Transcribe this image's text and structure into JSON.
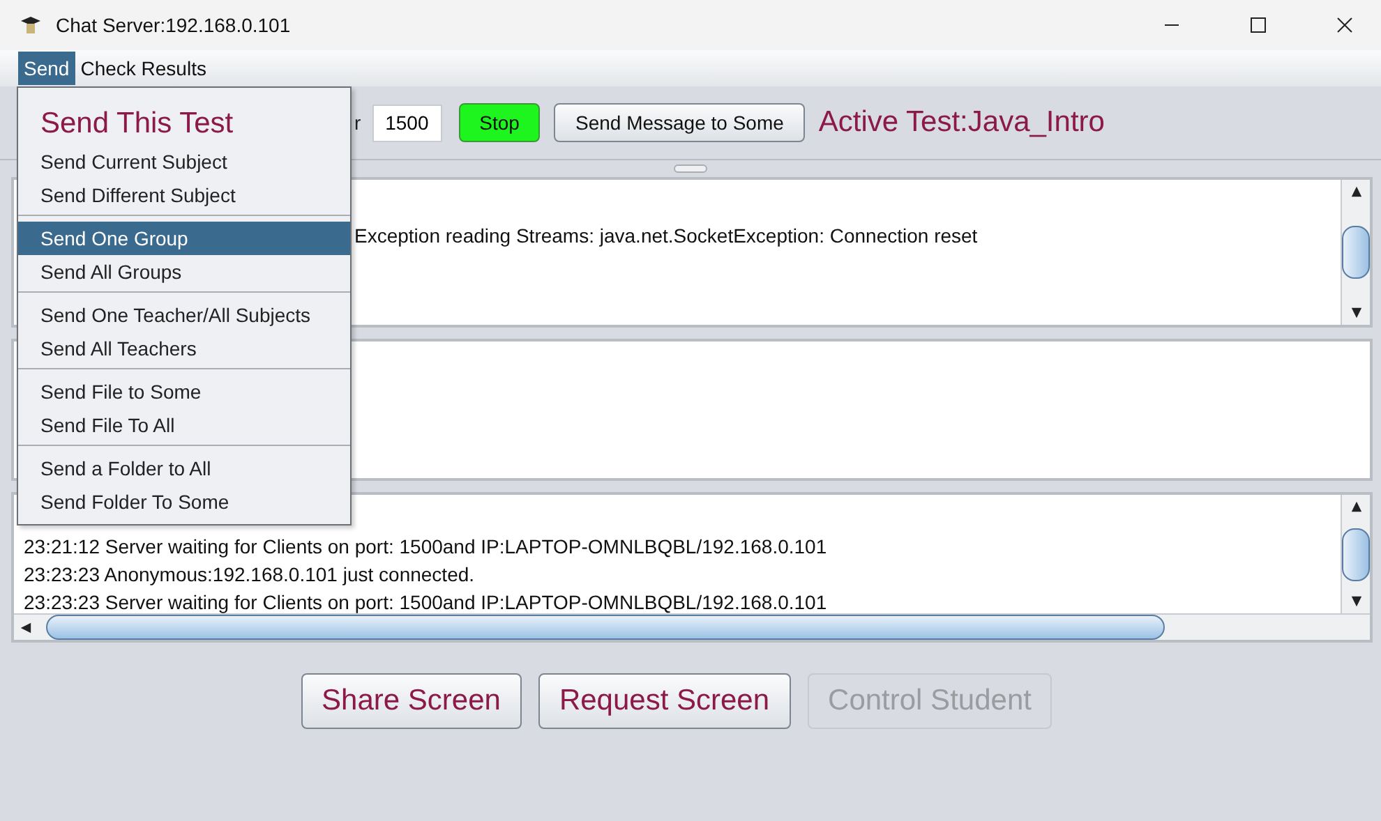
{
  "window": {
    "title": "Chat Server:192.168.0.101"
  },
  "menubar": [
    {
      "label": "Send",
      "selected": true
    },
    {
      "label": "Check Results",
      "selected": false
    }
  ],
  "menu": {
    "title": "Send This Test",
    "groups": [
      [
        {
          "label": "Send Current Subject",
          "selected": false
        },
        {
          "label": "Send Different Subject",
          "selected": false
        }
      ],
      [
        {
          "label": "Send One Group",
          "selected": true
        },
        {
          "label": "Send All Groups",
          "selected": false
        }
      ],
      [
        {
          "label": "Send One Teacher/All Subjects",
          "selected": false
        },
        {
          "label": "Send All Teachers",
          "selected": false
        }
      ],
      [
        {
          "label": "Send File to Some",
          "selected": false
        },
        {
          "label": "Send File To All",
          "selected": false
        }
      ],
      [
        {
          "label": "Send a Folder to All",
          "selected": false
        },
        {
          "label": "Send Folder To Some",
          "selected": false
        }
      ]
    ]
  },
  "toolbar": {
    "port_label": "r",
    "port": "1500",
    "stop_button": "Stop",
    "send_message_button": "Send Message to Some",
    "active_test": "Active Test:Java_Intro"
  },
  "message_log": [
    "Exception reading Streams: java.net.SocketException: Connection reset"
  ],
  "server_log": [
    "23:21:12 Server waiting for Clients on port: 1500and IP:LAPTOP-OMNLBQBL/192.168.0.101",
    "23:23:23 Anonymous:192.168.0.101 just connected.",
    "23:23:23 Server waiting for Clients on port: 1500and IP:LAPTOP-OMNLBQBL/192.168.0.101"
  ],
  "buttons": [
    {
      "label": "Share Screen",
      "disabled": false
    },
    {
      "label": "Request Screen",
      "disabled": false
    },
    {
      "label": "Control Student",
      "disabled": true
    }
  ]
}
